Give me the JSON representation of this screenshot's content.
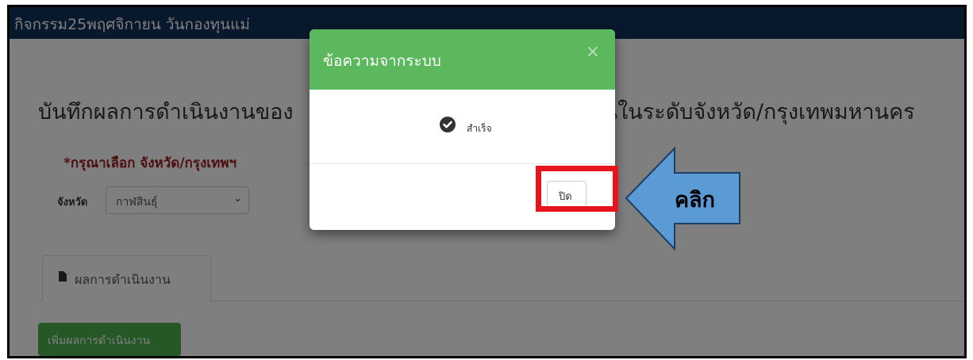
{
  "topbar": {
    "title": "กิจกรรม25พฤศจิกายน วันกองทุนแม่"
  },
  "page": {
    "heading": "บันทึกผลการดำเนินงานของ                                    นในระดับจังหวัด/กรุงเทพมหานคร",
    "heading_left": "บันทึกผลการดำเนินงานของ",
    "heading_right": "นในระดับจังหวัด/กรุงเทพมหานคร"
  },
  "province": {
    "title": "*กรุณาเลือก จังหวัด/กรุงเทพฯ",
    "label": "จังหวัด",
    "selected": "กาฬสินธุ์"
  },
  "tabs": [
    {
      "label": "ผลการดำเนินงาน",
      "icon": "document-icon"
    }
  ],
  "buttons": {
    "add": "เพิ่มผลการดำเนินงาน"
  },
  "modal": {
    "title": "ข้อความจากระบบ",
    "close_x": "×",
    "message": "สำเร็จ",
    "close_button": "ปิด",
    "status_icon": "check-circle-icon"
  },
  "annotation": {
    "arrow_label": "คลิก",
    "arrow_color": "#5b9bd5",
    "highlight_color": "#e8141b"
  },
  "colors": {
    "topbar": "#13325a",
    "modal_header": "#5cb85c",
    "add_button": "#4cae4c",
    "required_text": "#9b1c1c"
  }
}
